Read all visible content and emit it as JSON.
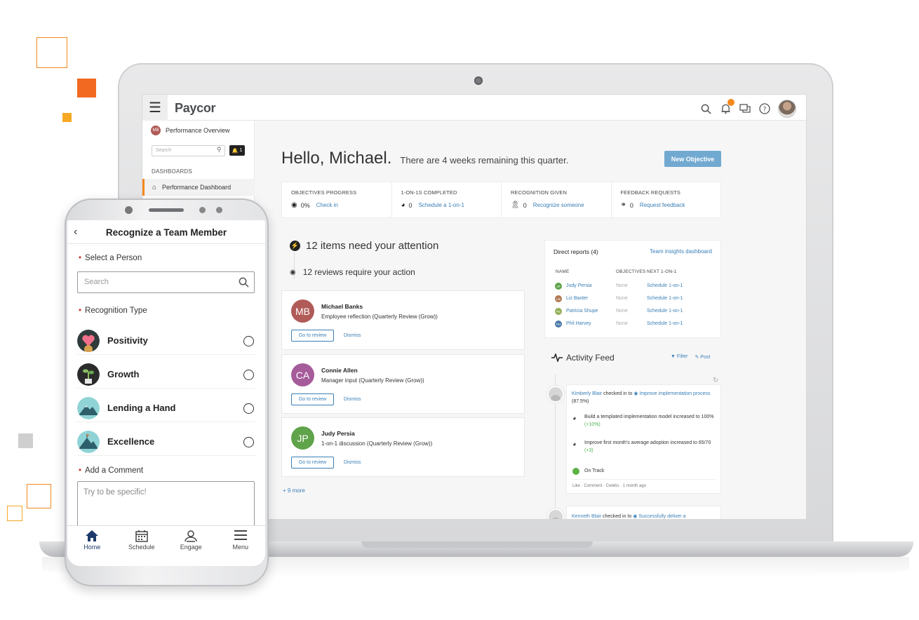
{
  "laptop": {
    "app": {
      "logo": "Paycor",
      "sidebar": {
        "header_initials": "MB",
        "header_title": "Performance Overview",
        "search_placeholder": "Search",
        "notif_count": "1",
        "section": "DASHBOARDS",
        "active_item": "Performance Dashboard"
      },
      "greeting": "Hello, Michael.",
      "subgreeting": "There are 4 weeks remaining this quarter.",
      "new_objective": "New Objective",
      "stats": [
        {
          "label": "OBJECTIVES PROGRESS",
          "value": "0%",
          "link": "Check in",
          "icon": "target-icon"
        },
        {
          "label": "1-ON-1S COMPLETED",
          "value": "0",
          "link": "Schedule a 1-on-1",
          "icon": "handshake-icon"
        },
        {
          "label": "RECOGNITION GIVEN",
          "value": "0",
          "link": "Recognize someone",
          "icon": "award-icon"
        },
        {
          "label": "FEEDBACK REQUESTS",
          "value": "0",
          "link": "Request feedback",
          "icon": "feedback-icon"
        }
      ],
      "attention": "12 items need your attention",
      "reviews_action": "12 reviews require your action",
      "review_cards": [
        {
          "initials": "MB",
          "name": "Michael Banks",
          "desc": "Employee reflection (Quarterly Review (Grow))",
          "button": "Go to review",
          "dismiss": "Dismiss",
          "color": "#b05b58"
        },
        {
          "initials": "CA",
          "name": "Connie Allen",
          "desc": "Manager input (Quarterly Review (Grow))",
          "button": "Go to review",
          "dismiss": "Dismiss",
          "color": "#a65b9a"
        },
        {
          "initials": "JP",
          "name": "Judy Persia",
          "desc": "1-on-1 discussion (Quarterly Review (Grow))",
          "button": "Go to review",
          "dismiss": "Dismiss",
          "color": "#5fa34a"
        }
      ],
      "more_link": "+ 9 more",
      "direct_reports": {
        "title": "Direct reports (4)",
        "link": "Team insights dashboard",
        "headers": [
          "NAME",
          "OBJECTIVES",
          "NEXT 1-ON-1"
        ],
        "rows": [
          {
            "initials": "JP",
            "name": "Judy Persia",
            "objectives": "None",
            "next": "Schedule 1-on-1",
            "color": "#5fa34a"
          },
          {
            "initials": "LB",
            "name": "Liz Baxter",
            "objectives": "None",
            "next": "Schedule 1-on-1",
            "color": "#b07a52"
          },
          {
            "initials": "PS",
            "name": "Patricia Shupe",
            "objectives": "None",
            "next": "Schedule 1-on-1",
            "color": "#8fae55"
          },
          {
            "initials": "PH",
            "name": "Phil Harvey",
            "objectives": "None",
            "next": "Schedule 1-on-1",
            "color": "#4b79a8"
          }
        ]
      },
      "activity": {
        "title": "Activity Feed",
        "filter": "Filter",
        "post": "Post",
        "entry1": {
          "author": "Kimberly Blair",
          "verb": "checked in to",
          "objective": "Improve implementation process",
          "pct": "(87.5%)",
          "kr1_text": "Build a templated implementation model increased to",
          "kr1_value": "100%",
          "kr1_delta": "(+10%)",
          "kr2_text": "Improve first month's average adoption increased to",
          "kr2_value": "65/70",
          "kr2_delta": "(+3)",
          "status": "On Track",
          "footer": "Like · Comment · Celebs · 1 month ago"
        },
        "entry2": {
          "author": "Kenneth Blair",
          "verb": "checked in to",
          "objective": "Successfully deliver a"
        }
      }
    }
  },
  "phone": {
    "title": "Recognize a Team Member",
    "select_person_label": "Select a Person",
    "search_placeholder": "Search",
    "recognition_type_label": "Recognition Type",
    "types": [
      {
        "name": "Positivity"
      },
      {
        "name": "Growth"
      },
      {
        "name": "Lending a Hand"
      },
      {
        "name": "Excellence"
      }
    ],
    "comment_label": "Add a Comment",
    "comment_placeholder": "Try to be specific!",
    "nav": [
      {
        "label": "Home",
        "icon": "home-icon"
      },
      {
        "label": "Schedule",
        "icon": "calendar-icon"
      },
      {
        "label": "Engage",
        "icon": "engage-icon"
      },
      {
        "label": "Menu",
        "icon": "menu-icon"
      }
    ]
  },
  "colors": {
    "brand_orange": "#f5891f",
    "link_blue": "#3a7fb6",
    "button_blue": "#72a9d0",
    "deco_gray": "#cfcfcf"
  }
}
